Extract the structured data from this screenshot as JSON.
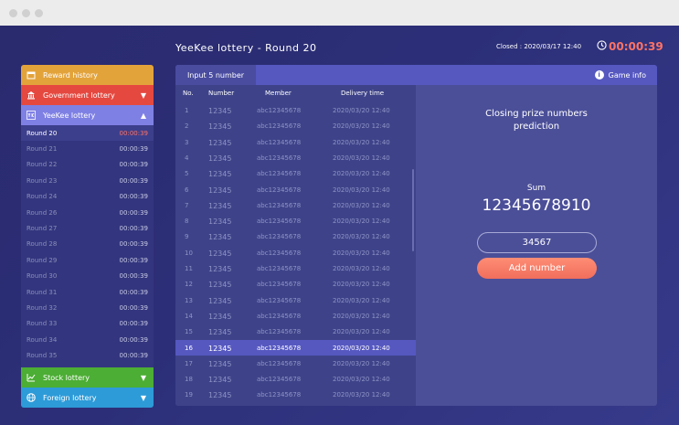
{
  "header": {
    "title": "YeeKee lottery - Round 20",
    "closed_text": "Closed : 2020/03/17 12:40",
    "countdown": "00:00:39"
  },
  "sidebar": {
    "reward_history": "Reward history",
    "government_lottery": "Government lottery",
    "yeekee_lottery": "YeeKee lottery",
    "rounds": [
      {
        "label": "Round 20",
        "time": "00:00:39"
      },
      {
        "label": "Round 21",
        "time": "00:00:39"
      },
      {
        "label": "Round 22",
        "time": "00:00:39"
      },
      {
        "label": "Round 23",
        "time": "00:00:39"
      },
      {
        "label": "Round 24",
        "time": "00:00:39"
      },
      {
        "label": "Round 26",
        "time": "00:00:39"
      },
      {
        "label": "Round 27",
        "time": "00:00:39"
      },
      {
        "label": "Round 28",
        "time": "00:00:39"
      },
      {
        "label": "Round 29",
        "time": "00:00:39"
      },
      {
        "label": "Round 30",
        "time": "00:00:39"
      },
      {
        "label": "Round 31",
        "time": "00:00:39"
      },
      {
        "label": "Round 32",
        "time": "00:00:39"
      },
      {
        "label": "Round 33",
        "time": "00:00:39"
      },
      {
        "label": "Round 34",
        "time": "00:00:39"
      },
      {
        "label": "Round 35",
        "time": "00:00:39"
      }
    ],
    "stock_lottery": "Stock lottery",
    "foreign_lottery": "Foreign lottery"
  },
  "tabs": {
    "input_label": "Input 5 number",
    "game_info": "Game info"
  },
  "table": {
    "headers": {
      "no": "No.",
      "number": "Number",
      "member": "Member",
      "delivery": "Delivery time"
    },
    "rows": [
      {
        "no": "1",
        "number": "12345",
        "member": "abc12345678",
        "time": "2020/03/20 12:40"
      },
      {
        "no": "2",
        "number": "12345",
        "member": "abc12345678",
        "time": "2020/03/20 12:40"
      },
      {
        "no": "3",
        "number": "12345",
        "member": "abc12345678",
        "time": "2020/03/20 12:40"
      },
      {
        "no": "4",
        "number": "12345",
        "member": "abc12345678",
        "time": "2020/03/20 12:40"
      },
      {
        "no": "5",
        "number": "12345",
        "member": "abc12345678",
        "time": "2020/03/20 12:40"
      },
      {
        "no": "6",
        "number": "12345",
        "member": "abc12345678",
        "time": "2020/03/20 12:40"
      },
      {
        "no": "7",
        "number": "12345",
        "member": "abc12345678",
        "time": "2020/03/20 12:40"
      },
      {
        "no": "8",
        "number": "12345",
        "member": "abc12345678",
        "time": "2020/03/20 12:40"
      },
      {
        "no": "9",
        "number": "12345",
        "member": "abc12345678",
        "time": "2020/03/20 12:40"
      },
      {
        "no": "10",
        "number": "12345",
        "member": "abc12345678",
        "time": "2020/03/20 12:40"
      },
      {
        "no": "11",
        "number": "12345",
        "member": "abc12345678",
        "time": "2020/03/20 12:40"
      },
      {
        "no": "12",
        "number": "12345",
        "member": "abc12345678",
        "time": "2020/03/20 12:40"
      },
      {
        "no": "13",
        "number": "12345",
        "member": "abc12345678",
        "time": "2020/03/20 12:40"
      },
      {
        "no": "14",
        "number": "12345",
        "member": "abc12345678",
        "time": "2020/03/20 12:40"
      },
      {
        "no": "15",
        "number": "12345",
        "member": "abc12345678",
        "time": "2020/03/20 12:40"
      },
      {
        "no": "16",
        "number": "12345",
        "member": "abc12345678",
        "time": "2020/03/20 12:40"
      },
      {
        "no": "17",
        "number": "12345",
        "member": "abc12345678",
        "time": "2020/03/20 12:40"
      },
      {
        "no": "18",
        "number": "12345",
        "member": "abc12345678",
        "time": "2020/03/20 12:40"
      },
      {
        "no": "19",
        "number": "12345",
        "member": "abc12345678",
        "time": "2020/03/20 12:40"
      }
    ]
  },
  "prediction": {
    "title_line1": "Closing prize numbers",
    "title_line2": "prediction",
    "sum_label": "Sum",
    "sum_value": "12345678910",
    "input_value": "34567",
    "add_button": "Add number"
  },
  "colors": {
    "accent": "#5658c0",
    "countdown": "#ff7366",
    "reward_history": "#e3a33b",
    "government_lottery": "#e5483f",
    "yeekee_lottery": "#7f80e4",
    "stock_lottery": "#4cae34",
    "foreign_lottery": "#2d9bd8"
  }
}
